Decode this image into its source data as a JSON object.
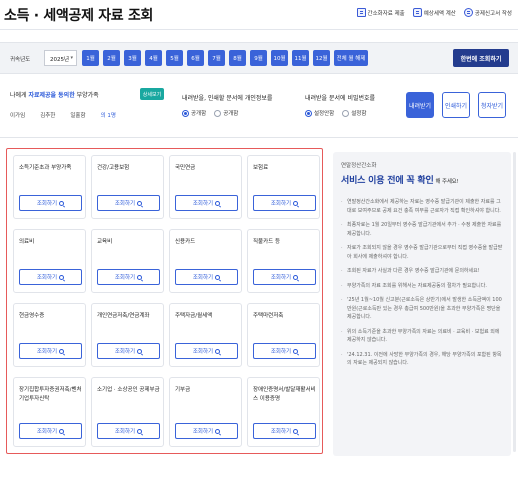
{
  "header": {
    "title": "소득 · 세액공제 자료 조회",
    "links": [
      {
        "label": "간소화자료 제출",
        "icon": "doc-icon"
      },
      {
        "label": "예상세액 계산",
        "icon": "calculator-icon"
      },
      {
        "label": "공제신고서 작성",
        "icon": "form-icon"
      }
    ]
  },
  "year_bar": {
    "label": "귀속년도",
    "year_value": "2025년",
    "months": [
      "1월",
      "2월",
      "3월",
      "4월",
      "5월",
      "6월",
      "7월",
      "8월",
      "9월",
      "10월",
      "11월",
      "12월"
    ],
    "all_label": "전체 월 해제",
    "search_all_label": "한번에 조회하기"
  },
  "options": {
    "consent": {
      "prefix": "나에게 ",
      "highlight": "자료제공을 동의한",
      "suffix": " 부양가족",
      "detail_label": "상세보기",
      "people": [
        "이가임",
        "김추한",
        "일홀함",
        "의 1명"
      ]
    },
    "personal_info": {
      "heading": "내려받을, 인쇄할 문서에 개인정보를",
      "options": [
        "공개함",
        "공개함"
      ],
      "selected": 0
    },
    "password": {
      "heading": "내려받을 문서에 비밀번호를",
      "options": [
        "설정안함",
        "설정함"
      ],
      "selected": 0
    },
    "actions": [
      "내려받기",
      "인쇄하기",
      "청자받기"
    ]
  },
  "cards": [
    {
      "title": "소득기준초과 부양가족",
      "button": "조회하기"
    },
    {
      "title": "건강/고용보험",
      "button": "조회하기"
    },
    {
      "title": "국민연금",
      "button": "조회하기"
    },
    {
      "title": "보험료",
      "button": "조회하기"
    },
    {
      "title": "의료비",
      "button": "조회하기"
    },
    {
      "title": "교육비",
      "button": "조회하기"
    },
    {
      "title": "신용카드",
      "button": "조회하기"
    },
    {
      "title": "직불카드 등",
      "button": "조회하기"
    },
    {
      "title": "현금영수증",
      "button": "조회하기"
    },
    {
      "title": "개인연금저축/연금계좌",
      "button": "조회하기"
    },
    {
      "title": "주택자금/월세액",
      "button": "조회하기"
    },
    {
      "title": "주택마련저축",
      "button": "조회하기"
    },
    {
      "title": "장기집합투자증권저축/벤처기업투자신탁",
      "button": "조회하기"
    },
    {
      "title": "소기업 · 소상공인 공제부금",
      "button": "조회하기"
    },
    {
      "title": "기부금",
      "button": "조회하기"
    },
    {
      "title": "장애인증명서/발달재활서비스 이용증명",
      "button": "조회하기"
    }
  ],
  "notice": {
    "subtitle": "연말정산간소화",
    "title": "서비스 이용 전에 꼭 확인",
    "title_suffix": "해 주세요!",
    "items": [
      "연말정산간소화에서 제공하는 자료는 영수증 발급기관이 제출한 자료를 그대로 보여주므로 공제 요건 충족 여부를 근로자가 직접 확인하셔야 합니다.",
      "최종자료는 1월 20일부터 영수증 발급기관에서 추가 · 수정 제출한 자료를 제공합니다.",
      "자료가 조회되지 않을 경우 영수증 발급기관으로부터 직접 영수증을 발급받아 회사에 제출하셔야 합니다.",
      "조회된 자료가 사실과 다른 경우 영수증 발급기관에 문의하세요!",
      "부양가족의 자료 조회를 위해서는 자료제공동의 절차가 필요합니다.",
      "'25년 1월~10월 신고분(근로소득은 상반기)에서 발생한 소득금액이 100만원(근로소득만 있는 경우 총급여 500만원)을 초과한 부양가족은 명단을 제공합니다.",
      "위의 소득기준을 초과한 부양가족의 자료는 의료비 · 교육비 · 보험료 외에 제공하지 않습니다.",
      "'24.12.31. 이전에 사망한 부양가족의 경우, 해당 부양가족의 포함된 항목의 자료는 제공되지 않습니다."
    ]
  }
}
